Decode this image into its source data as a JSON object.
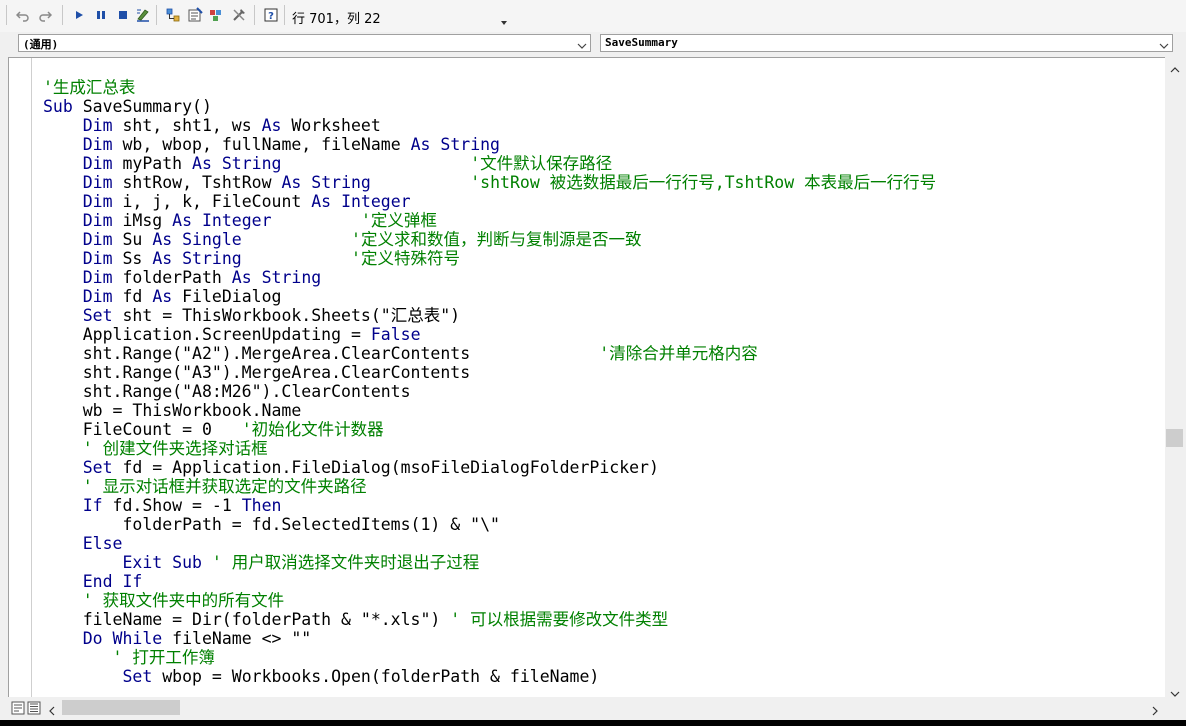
{
  "toolbar": {
    "buttons": [
      {
        "name": "undo-icon"
      },
      {
        "name": "redo-icon"
      },
      {
        "name": "run-icon"
      },
      {
        "name": "pause-icon"
      },
      {
        "name": "stop-icon"
      },
      {
        "name": "design-mode-icon"
      },
      {
        "name": "project-explorer-icon"
      },
      {
        "name": "properties-icon"
      },
      {
        "name": "toolbox-icon"
      },
      {
        "name": "help-icon"
      }
    ],
    "position_text": "行 701，列 22"
  },
  "object_combo": {
    "value": "(通用)"
  },
  "procedure_combo": {
    "value": "SaveSummary"
  },
  "colors": {
    "keyword": "#00008b",
    "comment": "#008000",
    "text": "#000000"
  },
  "code": {
    "lines": [
      [
        {
          "t": "'生成汇总表",
          "c": "cm"
        }
      ],
      [
        {
          "t": "Sub",
          "c": "kw"
        },
        {
          "t": " SaveSummary()"
        }
      ],
      [
        {
          "t": "    "
        },
        {
          "t": "Dim",
          "c": "kw"
        },
        {
          "t": " sht, sht1, ws "
        },
        {
          "t": "As",
          "c": "kw"
        },
        {
          "t": " Worksheet"
        }
      ],
      [
        {
          "t": "    "
        },
        {
          "t": "Dim",
          "c": "kw"
        },
        {
          "t": " wb, wbop, fullName, fileName "
        },
        {
          "t": "As",
          "c": "kw"
        },
        {
          "t": " "
        },
        {
          "t": "String",
          "c": "kw"
        }
      ],
      [
        {
          "t": "    "
        },
        {
          "t": "Dim",
          "c": "kw"
        },
        {
          "t": " myPath "
        },
        {
          "t": "As",
          "c": "kw"
        },
        {
          "t": " "
        },
        {
          "t": "String",
          "c": "kw"
        },
        {
          "t": "                   "
        },
        {
          "t": "'文件默认保存路径",
          "c": "cm"
        }
      ],
      [
        {
          "t": "    "
        },
        {
          "t": "Dim",
          "c": "kw"
        },
        {
          "t": " shtRow, TshtRow "
        },
        {
          "t": "As",
          "c": "kw"
        },
        {
          "t": " "
        },
        {
          "t": "String",
          "c": "kw"
        },
        {
          "t": "          "
        },
        {
          "t": "'shtRow 被选数据最后一行行号,TshtRow 本表最后一行行号",
          "c": "cm"
        }
      ],
      [
        {
          "t": "    "
        },
        {
          "t": "Dim",
          "c": "kw"
        },
        {
          "t": " i, j, k, FileCount "
        },
        {
          "t": "As",
          "c": "kw"
        },
        {
          "t": " "
        },
        {
          "t": "Integer",
          "c": "kw"
        }
      ],
      [
        {
          "t": "    "
        },
        {
          "t": "Dim",
          "c": "kw"
        },
        {
          "t": " iMsg "
        },
        {
          "t": "As",
          "c": "kw"
        },
        {
          "t": " "
        },
        {
          "t": "Integer",
          "c": "kw"
        },
        {
          "t": "         "
        },
        {
          "t": "'定义弹框",
          "c": "cm"
        }
      ],
      [
        {
          "t": "    "
        },
        {
          "t": "Dim",
          "c": "kw"
        },
        {
          "t": " Su "
        },
        {
          "t": "As",
          "c": "kw"
        },
        {
          "t": " "
        },
        {
          "t": "Single",
          "c": "kw"
        },
        {
          "t": "           "
        },
        {
          "t": "'定义求和数值，判断与复制源是否一致",
          "c": "cm"
        }
      ],
      [
        {
          "t": "    "
        },
        {
          "t": "Dim",
          "c": "kw"
        },
        {
          "t": " Ss "
        },
        {
          "t": "As",
          "c": "kw"
        },
        {
          "t": " "
        },
        {
          "t": "String",
          "c": "kw"
        },
        {
          "t": "           "
        },
        {
          "t": "'定义特殊符号",
          "c": "cm"
        }
      ],
      [
        {
          "t": "    "
        },
        {
          "t": "Dim",
          "c": "kw"
        },
        {
          "t": " folderPath "
        },
        {
          "t": "As",
          "c": "kw"
        },
        {
          "t": " "
        },
        {
          "t": "String",
          "c": "kw"
        }
      ],
      [
        {
          "t": "    "
        },
        {
          "t": "Dim",
          "c": "kw"
        },
        {
          "t": " fd "
        },
        {
          "t": "As",
          "c": "kw"
        },
        {
          "t": " FileDialog"
        }
      ],
      [
        {
          "t": "    "
        },
        {
          "t": "Set",
          "c": "kw"
        },
        {
          "t": " sht = ThisWorkbook.Sheets(\"汇总表\")"
        }
      ],
      [
        {
          "t": "    Application.ScreenUpdating = "
        },
        {
          "t": "False",
          "c": "kw"
        }
      ],
      [
        {
          "t": "    sht.Range(\"A2\").MergeArea.ClearContents             "
        },
        {
          "t": "'清除合并单元格内容",
          "c": "cm"
        }
      ],
      [
        {
          "t": "    sht.Range(\"A3\").MergeArea.ClearContents"
        }
      ],
      [
        {
          "t": "    sht.Range(\"A8:M26\").ClearContents"
        }
      ],
      [
        {
          "t": "    wb = ThisWorkbook.Name"
        }
      ],
      [
        {
          "t": "    FileCount = 0   "
        },
        {
          "t": "'初始化文件计数器",
          "c": "cm"
        }
      ],
      [
        {
          "t": "    "
        },
        {
          "t": "' 创建文件夹选择对话框",
          "c": "cm"
        }
      ],
      [
        {
          "t": "    "
        },
        {
          "t": "Set",
          "c": "kw"
        },
        {
          "t": " fd = Application.FileDialog(msoFileDialogFolderPicker)"
        }
      ],
      [
        {
          "t": "    "
        },
        {
          "t": "' 显示对话框并获取选定的文件夹路径",
          "c": "cm"
        }
      ],
      [
        {
          "t": "    "
        },
        {
          "t": "If",
          "c": "kw"
        },
        {
          "t": " fd.Show = -1 "
        },
        {
          "t": "Then",
          "c": "kw"
        }
      ],
      [
        {
          "t": "        folderPath = fd.SelectedItems(1) & \"\\\""
        }
      ],
      [
        {
          "t": "    "
        },
        {
          "t": "Else",
          "c": "kw"
        }
      ],
      [
        {
          "t": "        "
        },
        {
          "t": "Exit Sub",
          "c": "kw"
        },
        {
          "t": " "
        },
        {
          "t": "' 用户取消选择文件夹时退出子过程",
          "c": "cm"
        }
      ],
      [
        {
          "t": "    "
        },
        {
          "t": "End If",
          "c": "kw"
        }
      ],
      [
        {
          "t": "    "
        },
        {
          "t": "' 获取文件夹中的所有文件",
          "c": "cm"
        }
      ],
      [
        {
          "t": "    fileName = Dir(folderPath & \"*.xls\") "
        },
        {
          "t": "' 可以根据需要修改文件类型",
          "c": "cm"
        }
      ],
      [
        {
          "t": "    "
        },
        {
          "t": "Do While",
          "c": "kw"
        },
        {
          "t": " fileName <> \"\""
        }
      ],
      [
        {
          "t": "       "
        },
        {
          "t": "' 打开工作簿",
          "c": "cm"
        }
      ],
      [
        {
          "t": "        "
        },
        {
          "t": "Set",
          "c": "kw"
        },
        {
          "t": " wbop = Workbooks.Open(folderPath & fileName)"
        }
      ]
    ]
  }
}
